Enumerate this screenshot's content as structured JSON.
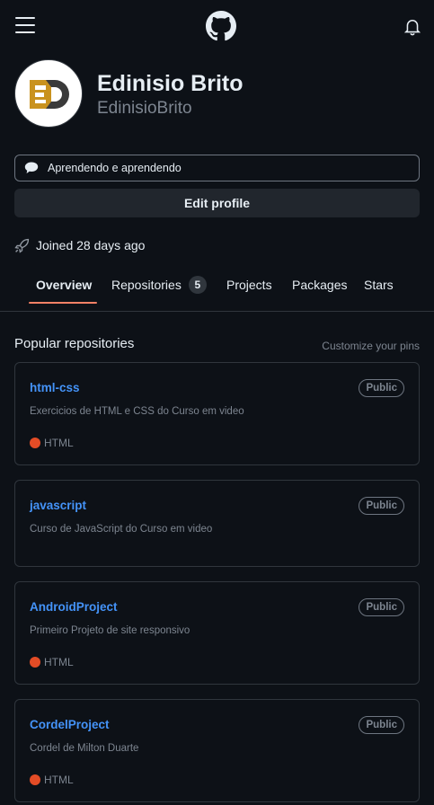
{
  "header": {
    "menu_icon": "hamburger-icon",
    "logo_icon": "github-logo-icon",
    "notifications_icon": "bell-icon"
  },
  "profile": {
    "avatar_text": "ED",
    "full_name": "Edinisio Brito",
    "username": "EdinisioBrito",
    "status_text": "Aprendendo e aprendendo",
    "edit_label": "Edit profile",
    "joined_text": "Joined 28 days ago"
  },
  "tabs": [
    {
      "label": "Overview",
      "active": true
    },
    {
      "label": "Repositories",
      "count": "5"
    },
    {
      "label": "Projects"
    },
    {
      "label": "Packages"
    },
    {
      "label": "Stars"
    }
  ],
  "popular": {
    "title": "Popular repositories",
    "customize_label": "Customize your pins"
  },
  "repos": [
    {
      "name": "html-css",
      "visibility": "Public",
      "description": "Exercicios de HTML e CSS do Curso em video",
      "language": "HTML"
    },
    {
      "name": "javascript",
      "visibility": "Public",
      "description": "Curso de JavaScript do Curso em video",
      "language": ""
    },
    {
      "name": "AndroidProject",
      "visibility": "Public",
      "description": "Primeiro Projeto de site responsivo",
      "language": "HTML"
    },
    {
      "name": "CordelProject",
      "visibility": "Public",
      "description": "Cordel de Milton Duarte",
      "language": "HTML"
    }
  ],
  "colors": {
    "background": "#0d1117",
    "link": "#4493f8",
    "html_lang": "#e34c26",
    "tab_underline": "#f78166",
    "avatar_gold": "#c9921e",
    "avatar_dark": "#3a3a3a"
  }
}
